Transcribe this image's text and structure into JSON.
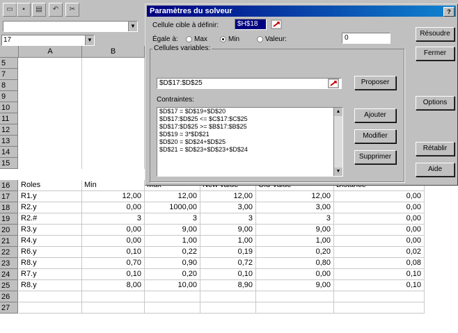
{
  "toolbar": {
    "buttons": [
      "new-icon",
      "save-icon",
      "open-icon",
      "undo-icon",
      "cut-icon"
    ]
  },
  "namebox": {
    "value": "17"
  },
  "columns": [
    "A",
    "B"
  ],
  "rows_before": [
    "5",
    "7",
    "8",
    "9",
    "10",
    "11",
    "12",
    "13",
    "14",
    "15"
  ],
  "table": {
    "header_row": "16",
    "headers": [
      "Roles",
      "Min",
      "Max",
      "New value",
      "Old Value",
      "Distance"
    ],
    "rows": [
      {
        "row": "17",
        "cells": [
          "R1.y",
          "12,00",
          "12,00",
          "12,00",
          "12,00",
          "0,00"
        ]
      },
      {
        "row": "18",
        "cells": [
          "R2.y",
          "0,00",
          "1000,00",
          "3,00",
          "3,00",
          "0,00"
        ]
      },
      {
        "row": "19",
        "cells": [
          "R2.#",
          "3",
          "3",
          "3",
          "3",
          "0,00"
        ]
      },
      {
        "row": "20",
        "cells": [
          "R3.y",
          "0,00",
          "9,00",
          "9,00",
          "9,00",
          "0,00"
        ]
      },
      {
        "row": "21",
        "cells": [
          "R4.y",
          "0,00",
          "1,00",
          "1,00",
          "1,00",
          "0,00"
        ]
      },
      {
        "row": "22",
        "cells": [
          "R6.y",
          "0,10",
          "0,22",
          "0,19",
          "0,20",
          "0,02"
        ]
      },
      {
        "row": "23",
        "cells": [
          "R8.y",
          "0,70",
          "0,90",
          "0,72",
          "0,80",
          "0,08"
        ]
      },
      {
        "row": "24",
        "cells": [
          "R7.y",
          "0,10",
          "0,20",
          "0,10",
          "0,00",
          "0,10"
        ]
      },
      {
        "row": "25",
        "cells": [
          "R8.y",
          "8,00",
          "10,00",
          "8,90",
          "9,00",
          "0,10"
        ]
      }
    ],
    "rows_after": [
      "26",
      "27"
    ]
  },
  "dialog": {
    "title": "Paramètres du solveur",
    "help": "?",
    "target_label": "Cellule cible à définir:",
    "target_value": "$H$18",
    "equal_label": "Égale à:",
    "opt_max": "Max",
    "opt_min": "Min",
    "opt_value": "Valeur:",
    "value_field": "0",
    "variables_label": "Cellules variables:",
    "variables_value": "$D$17:$D$25",
    "propose": "Proposer",
    "constraints_label": "Contraintes:",
    "constraints": [
      "$D$17 = $D$19+$D$20",
      "$D$17:$D$25 <= $C$17:$C$25",
      "$D$17:$D$25 >= $B$17:$B$25",
      "$D$19 = 3*$D$21",
      "$D$20 = $D$24+$D$25",
      "$D$21 = $D$23+$D$23+$D$24"
    ],
    "add": "Ajouter",
    "modify": "Modifier",
    "delete": "Supprimer",
    "solve": "Résoudre",
    "close": "Fermer",
    "options": "Options",
    "reset": "Rétablir",
    "help_btn": "Aide"
  }
}
